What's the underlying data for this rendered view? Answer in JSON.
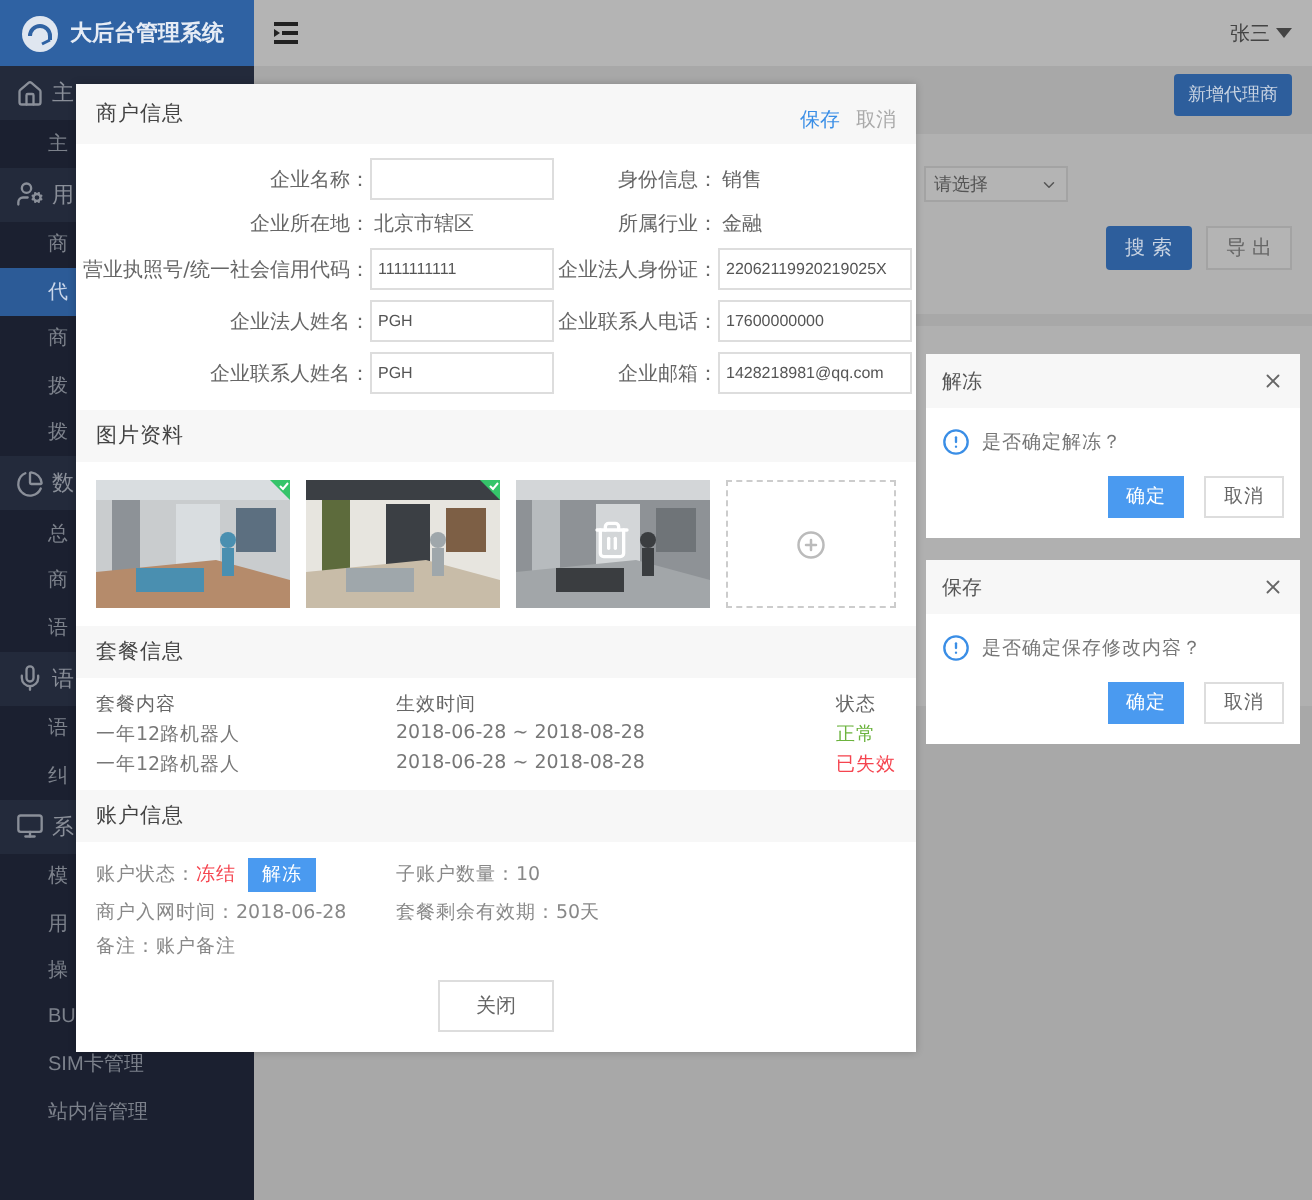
{
  "app": {
    "title": "大后台管理系统",
    "user": "张三"
  },
  "sidebar": {
    "groups": [
      {
        "label": "主",
        "items": [
          {
            "label": "主",
            "selected": false
          }
        ]
      },
      {
        "label": "用",
        "items": [
          {
            "label": "商",
            "selected": false
          },
          {
            "label": "代",
            "selected": true
          },
          {
            "label": "商",
            "selected": false
          },
          {
            "label": "拨",
            "selected": false
          },
          {
            "label": "拨",
            "selected": false
          }
        ]
      },
      {
        "label": "数",
        "items": [
          {
            "label": "总",
            "selected": false
          },
          {
            "label": "商",
            "selected": false
          },
          {
            "label": "语",
            "selected": false
          }
        ]
      },
      {
        "label": "语",
        "items": [
          {
            "label": "语",
            "selected": false
          },
          {
            "label": "纠",
            "selected": false
          }
        ]
      },
      {
        "label": "系",
        "items": [
          {
            "label": "模",
            "selected": false
          },
          {
            "label": "用",
            "selected": false
          },
          {
            "label": "操",
            "selected": false
          },
          {
            "label": "BU",
            "selected": false
          },
          {
            "label": "SIM卡管理",
            "selected": false
          },
          {
            "label": "站内信管理",
            "selected": false
          }
        ]
      }
    ]
  },
  "toolbar": {
    "add_button": "新增代理商",
    "select": {
      "placeholder": "请选择"
    },
    "search_button": "搜 索",
    "export_button": "导 出"
  },
  "modal": {
    "title": "商户信息",
    "actions": [
      {
        "label": "保存",
        "kind": "primary"
      },
      {
        "label": "取消",
        "kind": "plain"
      }
    ],
    "fields": [
      {
        "label": "企业名称：",
        "kind": "input"
      },
      {
        "label": "身份信息：",
        "kind": "text",
        "value": "销售"
      },
      {
        "label": "企业所在地：",
        "kind": "text",
        "value": "北京市辖区"
      },
      {
        "label": "所属行业：",
        "kind": "text",
        "value": "金融"
      },
      {
        "label": "营业执照号/统一社会信用代码：",
        "kind": "input",
        "value": "1111111111"
      },
      {
        "label": "企业法人身份证：",
        "kind": "input",
        "value": "22062119920219025X"
      },
      {
        "label": "企业法人姓名：",
        "kind": "input",
        "value": "PGH"
      },
      {
        "label": "企业联系人电话：",
        "kind": "input",
        "value": "17600000000"
      },
      {
        "label": "企业联系人姓名：",
        "kind": "input",
        "value": "PGH"
      },
      {
        "label": "企业邮箱：",
        "kind": "input",
        "value": "1428218981@qq.com"
      }
    ],
    "photos": {
      "title": "图片资料",
      "tiles": [
        {
          "kind": "picture",
          "verified": true,
          "delete_shown": false
        },
        {
          "kind": "picture",
          "verified": true,
          "delete_shown": false
        },
        {
          "kind": "picture",
          "verified": false,
          "delete_shown": true
        },
        {
          "kind": "add"
        }
      ]
    },
    "package": {
      "title": "套餐信息",
      "columns": [
        "套餐内容",
        "生效时间",
        "状态"
      ],
      "rows": [
        {
          "content": "一年12路机器人",
          "period": "2018-06-28 ~ 2018-08-28",
          "status": "正常",
          "kind": "active"
        },
        {
          "content": "一年12路机器人",
          "period": "2018-06-28 ~ 2018-08-28",
          "status": "已失效",
          "kind": "expired"
        }
      ]
    },
    "account": {
      "title": "账户信息",
      "items": [
        {
          "label": "账户状态：",
          "value": "冻结",
          "kind": "status",
          "action": "解冻"
        },
        {
          "label": "子账户数量：",
          "value": "10",
          "kind": "text"
        },
        {
          "label": "商户入网时间：",
          "value": "2018-06-28",
          "kind": "text"
        },
        {
          "label": "套餐剩余有效期：",
          "value": "50天",
          "kind": "text"
        },
        {
          "label": "备注：",
          "value": "账户备注",
          "kind": "text"
        }
      ]
    },
    "close_button": "关闭"
  },
  "dialogs": [
    {
      "title": "解冻",
      "message": "是否确定解冻？",
      "confirm": "确定",
      "cancel": "取消"
    },
    {
      "title": "保存",
      "message": "是否确定保存修改内容？",
      "confirm": "确定",
      "cancel": "取消"
    }
  ]
}
